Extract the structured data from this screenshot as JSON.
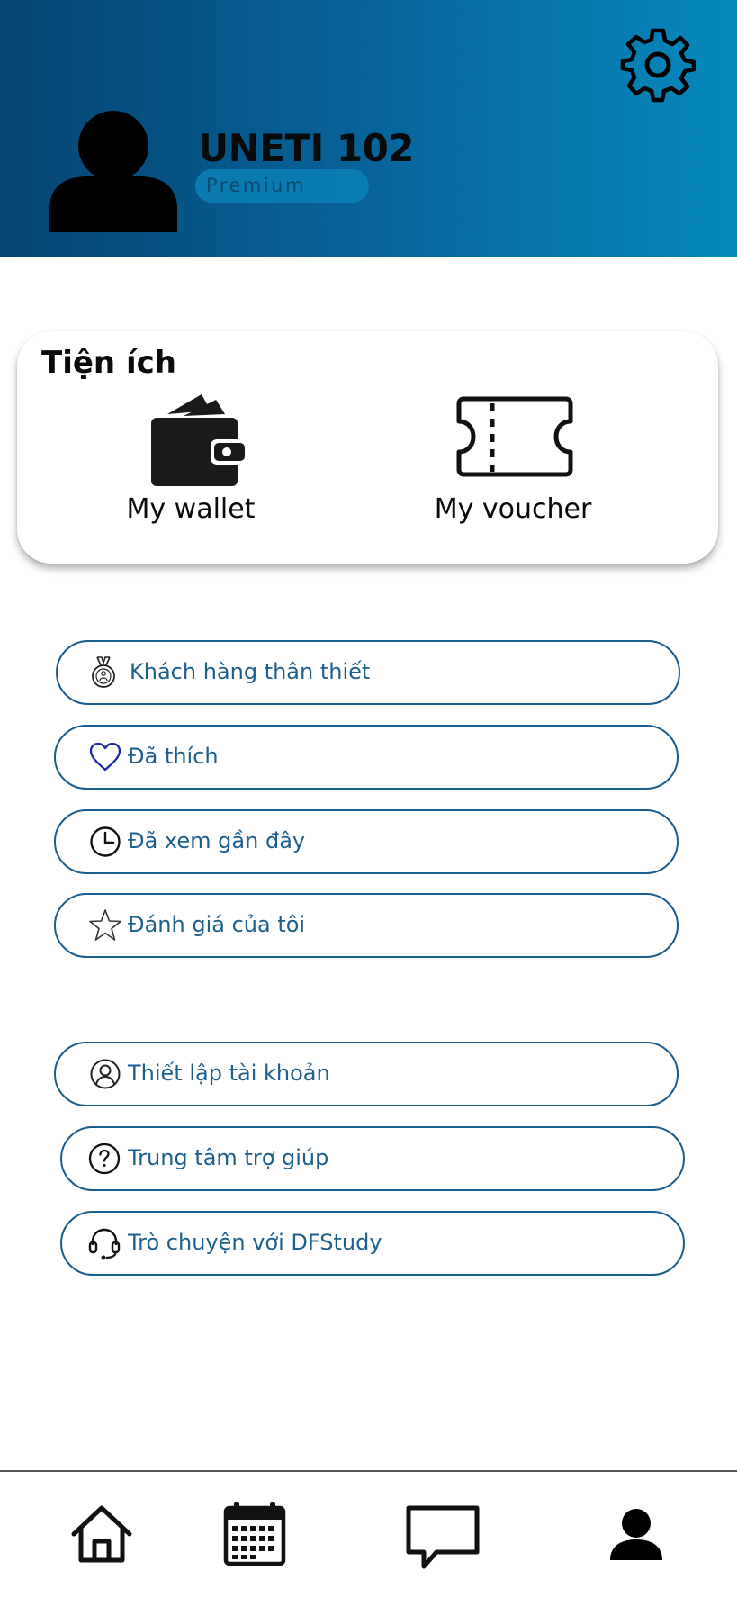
{
  "header": {
    "username": "UNETI 102",
    "badge": "Premium",
    "gradient": [
      "#064572",
      "#0689bd"
    ]
  },
  "utilities": {
    "title": "Tiện ích",
    "items": [
      {
        "label": "My wallet",
        "icon": "wallet-icon"
      },
      {
        "label": "My voucher",
        "icon": "ticket-icon"
      }
    ]
  },
  "menu": {
    "group1": [
      {
        "label": "Khách hàng thân thiết",
        "icon": "medal-icon"
      },
      {
        "label": "Đã thích",
        "icon": "heart-icon"
      },
      {
        "label": "Đã xem gần đây",
        "icon": "clock-icon"
      },
      {
        "label": "Đánh giá của tôi",
        "icon": "star-icon"
      }
    ],
    "group2": [
      {
        "label": "Thiết lập tài khoản",
        "icon": "user-circle-icon"
      },
      {
        "label": "Trung tâm trợ giúp",
        "icon": "help-icon"
      },
      {
        "label": "Trò chuyện với DFStudy",
        "icon": "headset-icon"
      }
    ],
    "border_color": "#1a5c8c",
    "text_color": "#1d5f8d"
  },
  "bottom_nav": [
    {
      "name": "home",
      "icon": "home-icon"
    },
    {
      "name": "calendar",
      "icon": "calendar-icon"
    },
    {
      "name": "chat",
      "icon": "chat-icon"
    },
    {
      "name": "profile",
      "icon": "profile-icon",
      "active": true
    }
  ]
}
